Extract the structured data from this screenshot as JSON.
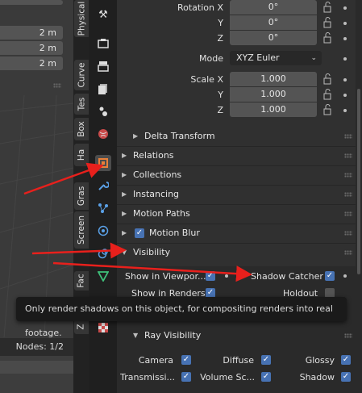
{
  "viewport": {
    "fields": [
      "2 m",
      "2 m",
      "2 m"
    ],
    "nodes_label": "Nodes: 1/2"
  },
  "tabs": [
    "Physical",
    "Curve",
    "Tes",
    "Box",
    "Ha",
    "Gras",
    "Screen",
    "Fac",
    "Z"
  ],
  "transform": {
    "rotation_x_label": "Rotation X",
    "rotation_y_label": "Y",
    "rotation_z_label": "Z",
    "rotation_x": "0°",
    "rotation_y": "0°",
    "rotation_z": "0°",
    "mode_label": "Mode",
    "mode_value": "XYZ Euler",
    "scale_x_label": "Scale X",
    "scale_y_label": "Y",
    "scale_z_label": "Z",
    "scale_x": "1.000",
    "scale_y": "1.000",
    "scale_z": "1.000",
    "delta_transform": "Delta Transform"
  },
  "sections": {
    "relations": "Relations",
    "collections": "Collections",
    "instancing": "Instancing",
    "motion_paths": "Motion Paths",
    "motion_blur": "Motion Blur",
    "visibility": "Visibility"
  },
  "visibility": {
    "show_in_viewports": "Show in Viewpor...",
    "shadow_catcher": "Shadow Catcher",
    "show_in_renders": "Show in Renders",
    "holdout": "Holdout",
    "ray_visibility": "Ray Visibility",
    "camera": "Camera",
    "diffuse": "Diffuse",
    "glossy": "Glossy",
    "transmission": "Transmissi...",
    "volume_scatter": "Volume Sc...",
    "shadow": "Shadow"
  },
  "tooltip": "Only render shadows on this object, for compositing renders into real footage.",
  "colors": {
    "accent": "#4772b3",
    "annotation_arrow": "#e8201c",
    "object_tab": "#e8803a"
  }
}
